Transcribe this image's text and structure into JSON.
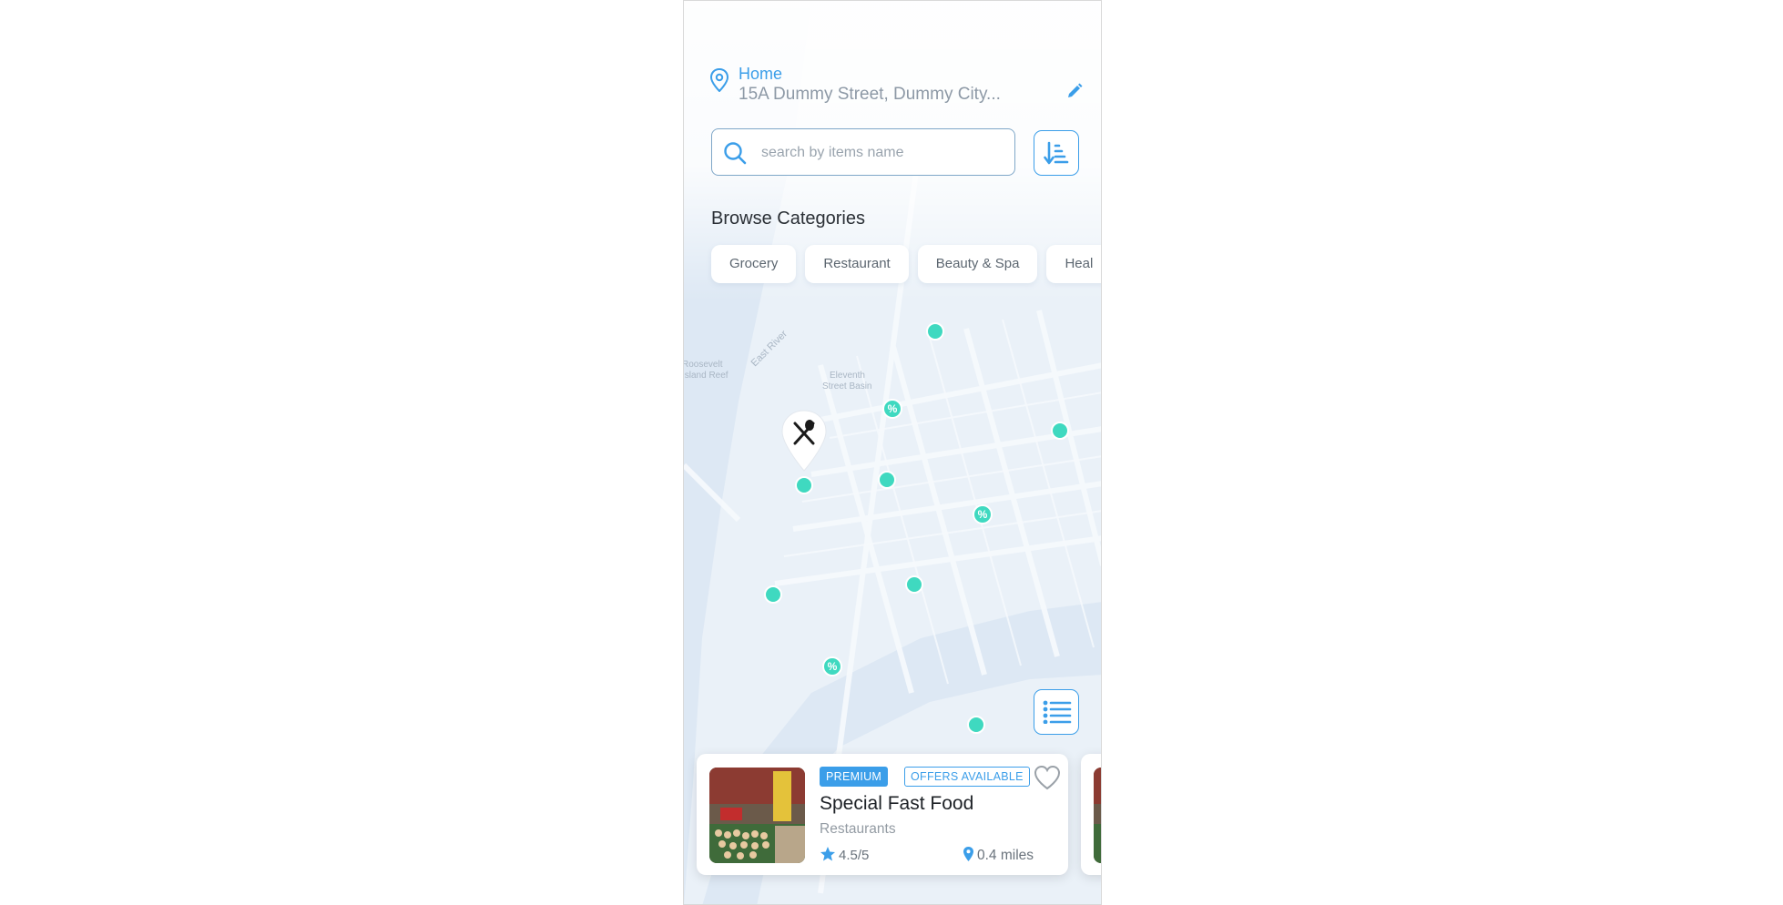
{
  "location": {
    "label": "Home",
    "address": "15A Dummy Street, Dummy City..."
  },
  "search": {
    "placeholder": "search by items name"
  },
  "categories": {
    "title": "Browse Categories",
    "items": [
      "Grocery",
      "Restaurant",
      "Beauty & Spa",
      "Heal"
    ]
  },
  "map": {
    "labels": [
      "East River",
      "Roosevelt Island Reef",
      "Eleventh Street Basin"
    ],
    "offer_symbol": "%"
  },
  "card": {
    "badge_premium": "PREMIUM",
    "badge_offers": "OFFERS AVAILABLE",
    "title": "Special Fast Food",
    "category": "Restaurants",
    "rating": "4.5/5",
    "distance": "0.4 miles"
  },
  "colors": {
    "accent": "#3b9ee9",
    "marker": "#3fd9c0",
    "title": "#2a2f35"
  },
  "icons": [
    "location-pin-icon",
    "edit-pencil-icon",
    "search-icon",
    "sort-icon",
    "restaurant-pin-icon",
    "list-view-icon",
    "heart-icon",
    "star-icon",
    "distance-pin-icon"
  ]
}
